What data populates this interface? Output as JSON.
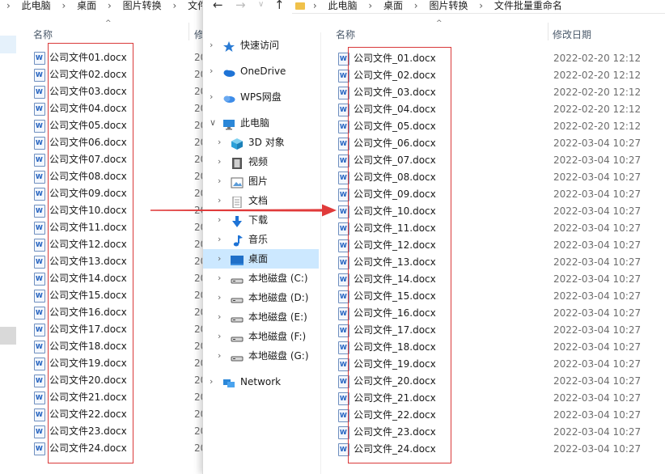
{
  "left_window": {
    "breadcrumb": [
      "此电脑",
      "桌面",
      "图片转换",
      "文件"
    ],
    "col_name": "名称",
    "col_date_partial": "修",
    "files": [
      "公司文件01.docx",
      "公司文件02.docx",
      "公司文件03.docx",
      "公司文件04.docx",
      "公司文件05.docx",
      "公司文件06.docx",
      "公司文件07.docx",
      "公司文件08.docx",
      "公司文件09.docx",
      "公司文件10.docx",
      "公司文件11.docx",
      "公司文件12.docx",
      "公司文件13.docx",
      "公司文件14.docx",
      "公司文件15.docx",
      "公司文件16.docx",
      "公司文件17.docx",
      "公司文件18.docx",
      "公司文件19.docx",
      "公司文件20.docx",
      "公司文件21.docx",
      "公司文件22.docx",
      "公司文件23.docx",
      "公司文件24.docx"
    ],
    "date_partial": "20"
  },
  "right_window": {
    "breadcrumb": [
      "此电脑",
      "桌面",
      "图片转换",
      "文件批量重命名"
    ],
    "col_name": "名称",
    "col_date": "修改日期",
    "nav": [
      {
        "label": "快速访问",
        "icon": "star-icon",
        "indent": 0,
        "expanded": false
      },
      {
        "label": "OneDrive",
        "icon": "cloud-icon",
        "indent": 0,
        "expanded": false
      },
      {
        "label": "WPS网盘",
        "icon": "wps-cloud-icon",
        "indent": 0,
        "expanded": false
      },
      {
        "label": "此电脑",
        "icon": "computer-icon",
        "indent": 0,
        "expanded": true
      },
      {
        "label": "3D 对象",
        "icon": "cube-icon",
        "indent": 1,
        "expanded": false
      },
      {
        "label": "视频",
        "icon": "film-icon",
        "indent": 1,
        "expanded": false
      },
      {
        "label": "图片",
        "icon": "picture-icon",
        "indent": 1,
        "expanded": false
      },
      {
        "label": "文档",
        "icon": "document-icon",
        "indent": 1,
        "expanded": false
      },
      {
        "label": "下载",
        "icon": "download-icon",
        "indent": 1,
        "expanded": false
      },
      {
        "label": "音乐",
        "icon": "music-icon",
        "indent": 1,
        "expanded": false
      },
      {
        "label": "桌面",
        "icon": "desktop-icon",
        "indent": 1,
        "expanded": false,
        "selected": true
      },
      {
        "label": "本地磁盘 (C:)",
        "icon": "drive-icon",
        "indent": 1,
        "expanded": false
      },
      {
        "label": "本地磁盘 (D:)",
        "icon": "drive-icon",
        "indent": 1,
        "expanded": false
      },
      {
        "label": "本地磁盘 (E:)",
        "icon": "drive-icon",
        "indent": 1,
        "expanded": false
      },
      {
        "label": "本地磁盘 (F:)",
        "icon": "drive-icon",
        "indent": 1,
        "expanded": false
      },
      {
        "label": "本地磁盘 (G:)",
        "icon": "drive-icon",
        "indent": 1,
        "expanded": false
      },
      {
        "label": "Network",
        "icon": "network-icon",
        "indent": 0,
        "expanded": false
      }
    ],
    "files": [
      {
        "name": "公司文件_01.docx",
        "date": "2022-02-20 12:12"
      },
      {
        "name": "公司文件_02.docx",
        "date": "2022-02-20 12:12"
      },
      {
        "name": "公司文件_03.docx",
        "date": "2022-02-20 12:12"
      },
      {
        "name": "公司文件_04.docx",
        "date": "2022-02-20 12:12"
      },
      {
        "name": "公司文件_05.docx",
        "date": "2022-02-20 12:12"
      },
      {
        "name": "公司文件_06.docx",
        "date": "2022-03-04 10:27"
      },
      {
        "name": "公司文件_07.docx",
        "date": "2022-03-04 10:27"
      },
      {
        "name": "公司文件_08.docx",
        "date": "2022-03-04 10:27"
      },
      {
        "name": "公司文件_09.docx",
        "date": "2022-03-04 10:27"
      },
      {
        "name": "公司文件_10.docx",
        "date": "2022-03-04 10:27"
      },
      {
        "name": "公司文件_11.docx",
        "date": "2022-03-04 10:27"
      },
      {
        "name": "公司文件_12.docx",
        "date": "2022-03-04 10:27"
      },
      {
        "name": "公司文件_13.docx",
        "date": "2022-03-04 10:27"
      },
      {
        "name": "公司文件_14.docx",
        "date": "2022-03-04 10:27"
      },
      {
        "name": "公司文件_15.docx",
        "date": "2022-03-04 10:27"
      },
      {
        "name": "公司文件_16.docx",
        "date": "2022-03-04 10:27"
      },
      {
        "name": "公司文件_17.docx",
        "date": "2022-03-04 10:27"
      },
      {
        "name": "公司文件_18.docx",
        "date": "2022-03-04 10:27"
      },
      {
        "name": "公司文件_19.docx",
        "date": "2022-03-04 10:27"
      },
      {
        "name": "公司文件_20.docx",
        "date": "2022-03-04 10:27"
      },
      {
        "name": "公司文件_21.docx",
        "date": "2022-03-04 10:27"
      },
      {
        "name": "公司文件_22.docx",
        "date": "2022-03-04 10:27"
      },
      {
        "name": "公司文件_23.docx",
        "date": "2022-03-04 10:27"
      },
      {
        "name": "公司文件_24.docx",
        "date": "2022-03-04 10:27"
      }
    ]
  },
  "colors": {
    "highlight_box": "#d9393a",
    "arrow": "#e03a3a",
    "nav_selected": "#cce8ff"
  }
}
